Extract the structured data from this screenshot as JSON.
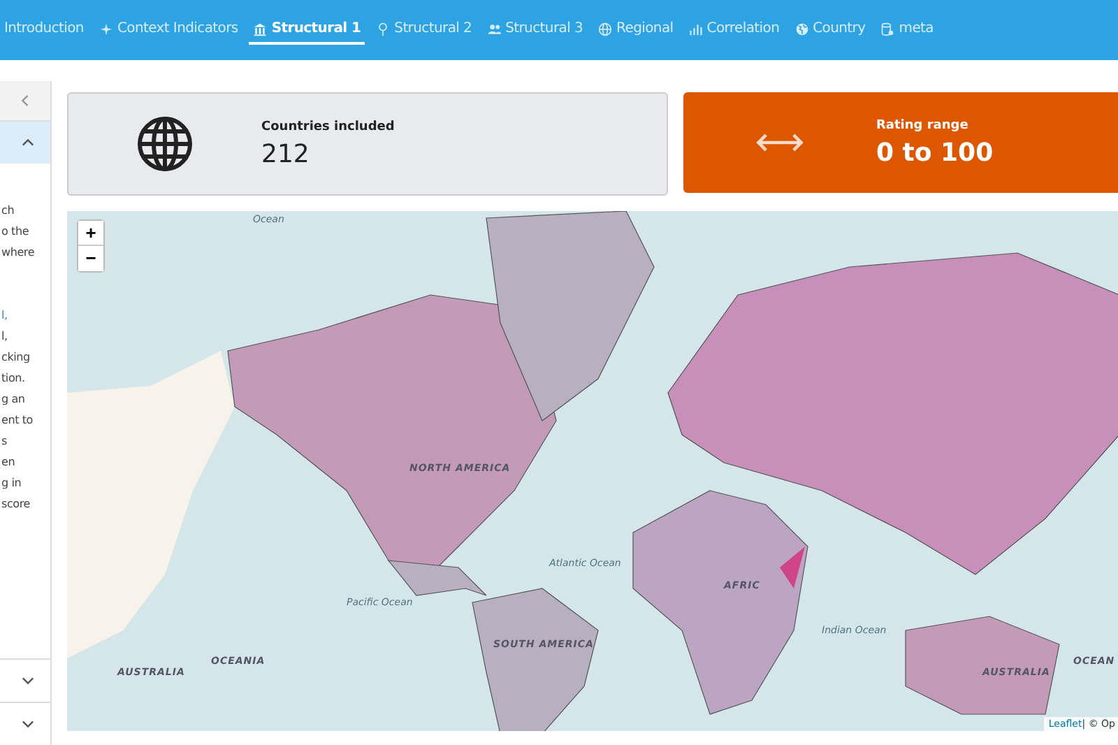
{
  "nav": {
    "tabs": [
      {
        "label": "Introduction",
        "selected": false
      },
      {
        "label": "Context Indicators",
        "selected": false
      },
      {
        "label": "Structural 1",
        "selected": true
      },
      {
        "label": "Structural 2",
        "selected": false
      },
      {
        "label": "Structural 3",
        "selected": false
      },
      {
        "label": "Regional",
        "selected": false
      },
      {
        "label": "Correlation",
        "selected": false
      },
      {
        "label": "Country",
        "selected": false
      },
      {
        "label": "meta",
        "selected": false
      }
    ]
  },
  "sidebar": {
    "sections": [
      {
        "expanded": true,
        "lines": [
          {
            "text": "ch",
            "kind": "text"
          },
          {
            "text": "o the",
            "kind": "text"
          },
          {
            "text": "where",
            "kind": "text"
          },
          {
            "text": "l,",
            "kind": "link"
          },
          {
            "text": "l,",
            "kind": "text"
          },
          {
            "text": "cking",
            "kind": "text"
          },
          {
            "text": "tion.",
            "kind": "text"
          },
          {
            "text": "g an",
            "kind": "text"
          },
          {
            "text": "ent to",
            "kind": "text"
          },
          {
            "text": "s",
            "kind": "text"
          },
          {
            "text": "en",
            "kind": "text"
          },
          {
            "text": "g in",
            "kind": "text"
          },
          {
            "text": "score",
            "kind": "text"
          }
        ]
      },
      {
        "expanded": false
      },
      {
        "expanded": false
      }
    ]
  },
  "cards": [
    {
      "title": "Countries included",
      "value": "212",
      "kind": "neutral"
    },
    {
      "title": "Rating range",
      "value": "0 to 100",
      "kind": "accent"
    }
  ],
  "map": {
    "zoom": [
      "+",
      "−"
    ],
    "labels": [
      {
        "text": "Ocean",
        "kind": "ocean"
      },
      {
        "text": "NORTH AMERICA",
        "kind": "continent"
      },
      {
        "text": "Atlantic Ocean",
        "kind": "ocean"
      },
      {
        "text": "Pacific Ocean",
        "kind": "ocean"
      },
      {
        "text": "SOUTH AMERICA",
        "kind": "continent"
      },
      {
        "text": "AFRIC",
        "kind": "continent"
      },
      {
        "text": "Indian Ocean",
        "kind": "ocean"
      },
      {
        "text": "OCEANIA",
        "kind": "continent"
      },
      {
        "text": "AUSTRALIA",
        "kind": "continent"
      },
      {
        "text": "AUSTRALIA",
        "kind": "continent"
      },
      {
        "text": "OCEAN",
        "kind": "continent"
      }
    ],
    "attribution": {
      "link": "Leaflet",
      "rest": "| © Op"
    }
  }
}
